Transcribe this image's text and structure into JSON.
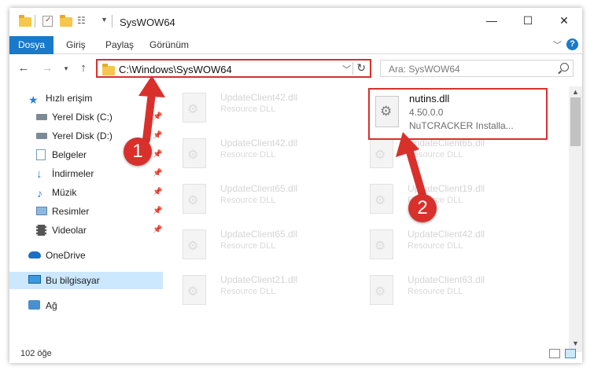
{
  "window": {
    "title": "SysWOW64",
    "minimize_label": "—",
    "maximize_label": "☐",
    "close_label": "✕"
  },
  "ribbon": {
    "tabs": [
      "Dosya",
      "Giriş",
      "Paylaş",
      "Görünüm"
    ],
    "help_label": "?"
  },
  "address": {
    "path": "C:\\Windows\\SysWOW64"
  },
  "search": {
    "placeholder": "Ara: SysWOW64"
  },
  "sidebar": {
    "items": [
      {
        "label": "Hızlı erişim",
        "icon": "star-icon",
        "pinned": false
      },
      {
        "label": "Yerel Disk (C:)",
        "icon": "drive-icon",
        "pinned": true
      },
      {
        "label": "Yerel Disk (D:)",
        "icon": "drive-icon",
        "pinned": true
      },
      {
        "label": "Belgeler",
        "icon": "documents-icon",
        "pinned": true
      },
      {
        "label": "İndirmeler",
        "icon": "download-icon",
        "pinned": true
      },
      {
        "label": "Müzik",
        "icon": "music-icon",
        "pinned": true
      },
      {
        "label": "Resimler",
        "icon": "pictures-icon",
        "pinned": true
      },
      {
        "label": "Videolar",
        "icon": "videos-icon",
        "pinned": true
      },
      {
        "label": "OneDrive",
        "icon": "cloud-icon",
        "pinned": false
      },
      {
        "label": "Bu bilgisayar",
        "icon": "computer-icon",
        "pinned": false,
        "selected": true
      },
      {
        "label": "Ağ",
        "icon": "network-icon",
        "pinned": false
      }
    ]
  },
  "files": [
    {
      "name": "UpdateClient42.dll",
      "type": "Resource DLL"
    },
    {
      "name": "UpdateClient42.dll",
      "type": "Resource DLL"
    },
    {
      "name": "UpdateClient65.dll",
      "type": "Resource DLL"
    },
    {
      "name": "UpdateClient65.dll",
      "type": "Resource DLL"
    },
    {
      "name": "UpdateClient21.dll",
      "type": "Resource DLL"
    },
    {
      "name": "UpdateClient65.dll",
      "type": "Resource DLL"
    },
    {
      "name": "UpdateClient19.dll",
      "type": "Resource DLL"
    },
    {
      "name": "UpdateClient42.dll",
      "type": "Resource DLL"
    },
    {
      "name": "UpdateClient63.dll",
      "type": "Resource DLL"
    }
  ],
  "target_file": {
    "name": "nutins.dll",
    "version": "4.50.0.0",
    "description": "NuTCRACKER Installa..."
  },
  "status": {
    "item_count": "102 öğe"
  },
  "callouts": [
    "1",
    "2"
  ],
  "colors": {
    "accent": "#1979ca",
    "highlight": "#d9302c",
    "selection": "#cce8ff"
  }
}
